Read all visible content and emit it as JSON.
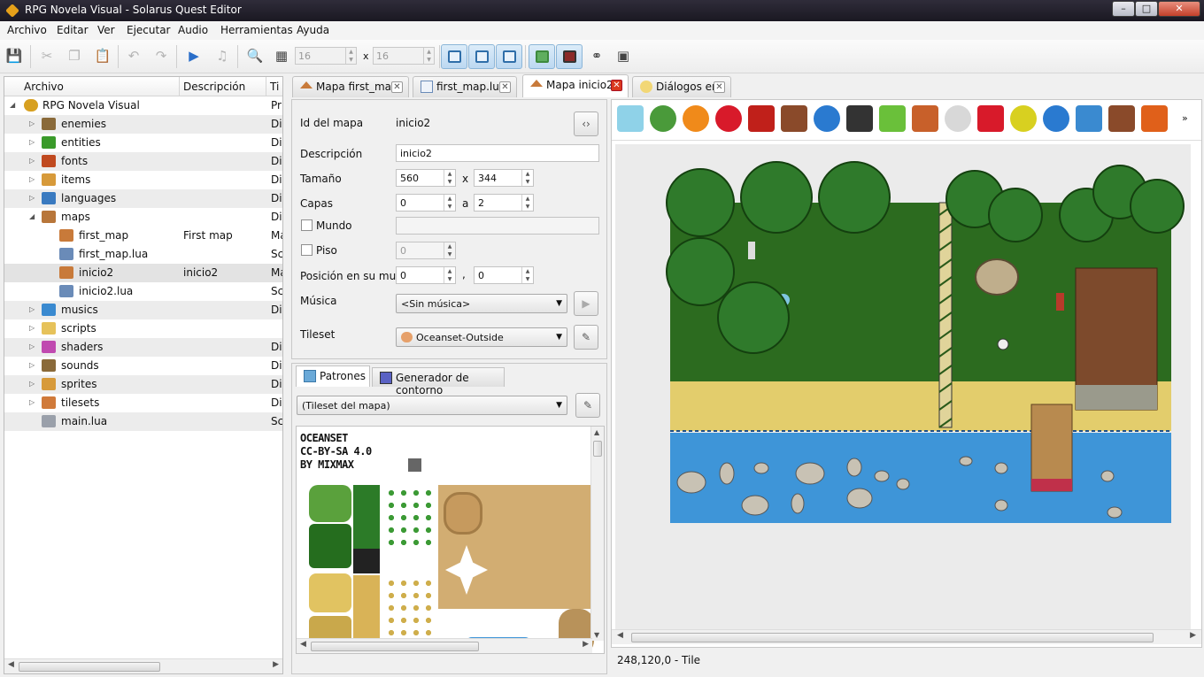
{
  "window": {
    "title": "RPG Novela Visual - Solarus Quest Editor",
    "min": "–",
    "max": "□",
    "close": "✕"
  },
  "menu": [
    "Archivo",
    "Editar",
    "Ver",
    "Ejecutar",
    "Audio",
    "Herramientas",
    "Ayuda"
  ],
  "toolbar": {
    "icons": [
      "save-icon",
      "cut-icon",
      "copy-icon",
      "paste-icon",
      "undo-icon",
      "redo-icon",
      "run-icon",
      "music-icon",
      "zoom-icon",
      "grid-icon"
    ],
    "grid_w": "16",
    "grid_h": "16",
    "times": "x"
  },
  "tree": {
    "headers": {
      "file": "Archivo",
      "desc": "Descripción",
      "type": "Ti"
    },
    "root": {
      "name": "RPG Novela Visual",
      "type": "Pr"
    },
    "items": [
      {
        "name": "enemies",
        "desc": "",
        "type": "Dir"
      },
      {
        "name": "entities",
        "desc": "",
        "type": "Dir"
      },
      {
        "name": "fonts",
        "desc": "",
        "type": "Dir"
      },
      {
        "name": "items",
        "desc": "",
        "type": "Dir"
      },
      {
        "name": "languages",
        "desc": "",
        "type": "Dir"
      },
      {
        "name": "maps",
        "desc": "",
        "type": "Dir"
      },
      {
        "name": "first_map",
        "desc": "First map",
        "type": "Ma"
      },
      {
        "name": "first_map.lua",
        "desc": "",
        "type": "Sc"
      },
      {
        "name": "inicio2",
        "desc": "inicio2",
        "type": "Ma"
      },
      {
        "name": "inicio2.lua",
        "desc": "",
        "type": "Sc"
      },
      {
        "name": "musics",
        "desc": "",
        "type": "Dir"
      },
      {
        "name": "scripts",
        "desc": "",
        "type": ""
      },
      {
        "name": "shaders",
        "desc": "",
        "type": "Dir"
      },
      {
        "name": "sounds",
        "desc": "",
        "type": "Dir"
      },
      {
        "name": "sprites",
        "desc": "",
        "type": "Dir"
      },
      {
        "name": "tilesets",
        "desc": "",
        "type": "Dir"
      },
      {
        "name": "main.lua",
        "desc": "",
        "type": "Sc"
      }
    ]
  },
  "tabs": [
    {
      "label": "Mapa first_map",
      "close": "✕"
    },
    {
      "label": "first_map.lua",
      "close": "✕"
    },
    {
      "label": "Mapa inicio2",
      "close": "✕"
    },
    {
      "label": "Diálogos en",
      "close": "✕"
    }
  ],
  "props": {
    "id_label": "Id del mapa",
    "id_value": "inicio2",
    "desc_label": "Descripción",
    "desc_value": "inicio2",
    "size_label": "Tamaño",
    "size_w": "560",
    "size_x": "x",
    "size_h": "344",
    "layers_label": "Capas",
    "layer_min": "0",
    "layer_a": "a",
    "layer_max": "2",
    "world_label": "Mundo",
    "floor_label": "Piso",
    "floor_value": "0",
    "pos_label": "Posición en su mundo",
    "pos_x": "0",
    "pos_comma": ",",
    "pos_y": "0",
    "music_label": "Música",
    "music_value": "<Sin música>",
    "tileset_label": "Tileset",
    "tileset_value": "Oceanset-Outside"
  },
  "patterns": {
    "tab1": "Patrones",
    "tab2": "Generador de contorno",
    "combo": "(Tileset del mapa)",
    "tileset_credit": [
      "OCEANSET",
      "CC-BY-SA 4.0",
      "BY MIXMAX"
    ]
  },
  "entity_icons": [
    "tile-icon",
    "destination-icon",
    "teletransporter-icon",
    "heart-pickable-icon",
    "pot-icon",
    "chest-icon",
    "jumper-icon",
    "enemy-icon",
    "npc-icon",
    "block-icon",
    "switch-icon",
    "wall-icon",
    "sensor-icon",
    "stream-icon",
    "crystal-icon",
    "shop-icon",
    "separator-icon"
  ],
  "colors": {
    "grass": "#2c6b1f",
    "sand": "#e3cd6c",
    "water": "#3e95d8",
    "tree": "#2f7a2b"
  },
  "status": "248,120,0 - Tile"
}
